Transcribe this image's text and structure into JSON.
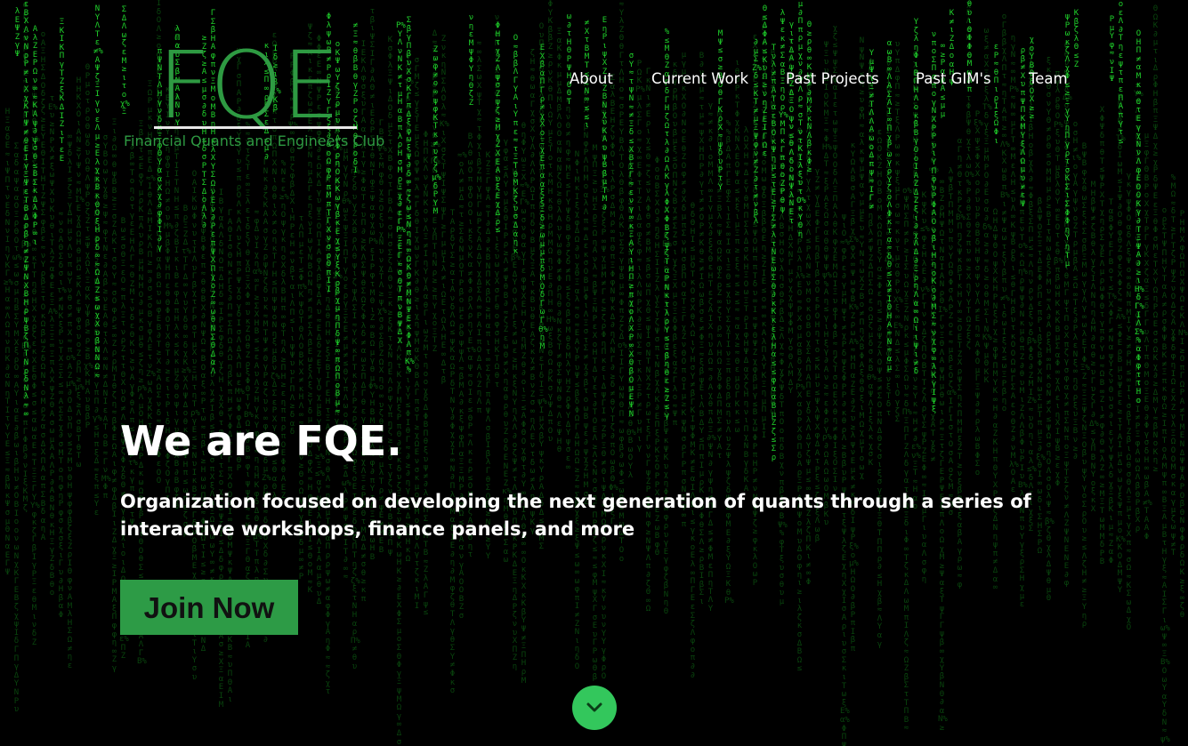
{
  "logo": {
    "letters": "FQE",
    "subtitle": "Financial Quants and Engineers Club"
  },
  "nav": {
    "items": [
      {
        "label": "About"
      },
      {
        "label": "Current Work"
      },
      {
        "label": "Past Projects"
      },
      {
        "label": "Past GIM's"
      },
      {
        "label": "Team"
      }
    ]
  },
  "hero": {
    "title": "We are FQE.",
    "subtitle": "Organization focused on developing the next generation of quants through a series of interactive workshops, finance panels, and more",
    "cta_label": "Join Now"
  },
  "scroll_button": {
    "icon": "chevron-down-icon"
  },
  "colors": {
    "brand_green": "#2e9a42",
    "button_green": "#2d9b46",
    "scroll_green": "#33c75c",
    "matrix_bright": "#1fd12b",
    "matrix_dim": "#0c5a12",
    "background": "#000000"
  }
}
